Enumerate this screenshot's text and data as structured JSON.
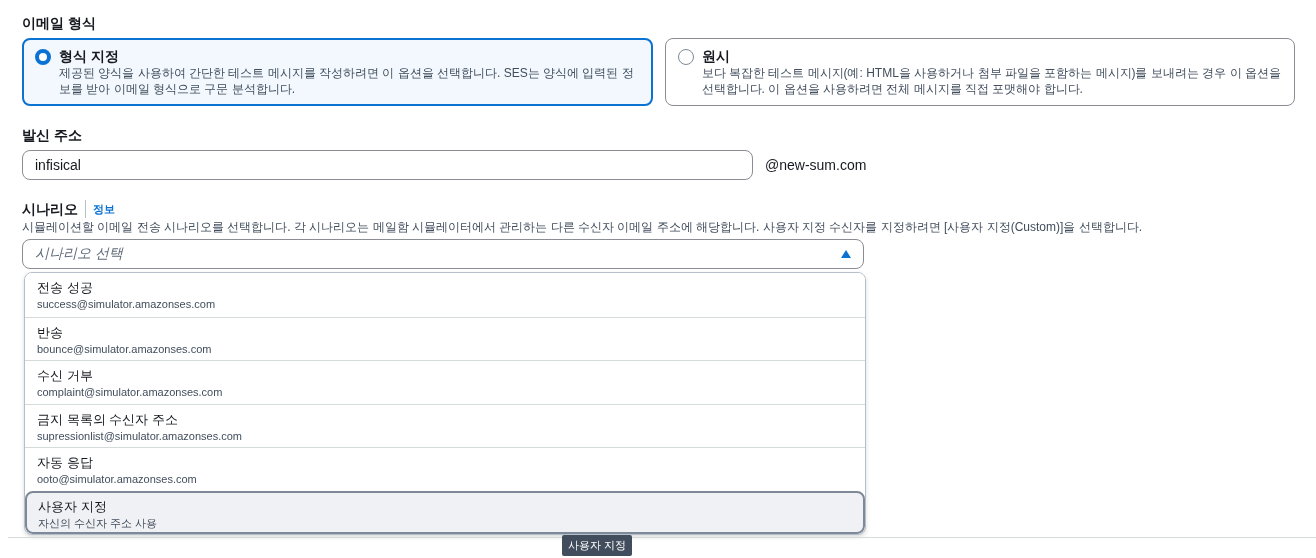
{
  "email_format": {
    "label": "이메일 형식",
    "options": [
      {
        "title": "형식 지정",
        "description": "제공된 양식을 사용하여 간단한 테스트 메시지를 작성하려면 이 옵션을 선택합니다. SES는 양식에 입력된 정보를 받아 이메일 형식으로 구문 분석합니다.",
        "selected": true
      },
      {
        "title": "원시",
        "description": "보다 복잡한 테스트 메시지(예: HTML을 사용하거나 첨부 파일을 포함하는 메시지)를 보내려는 경우 이 옵션을 선택합니다. 이 옵션을 사용하려면 전체 메시지를 직접 포맷해야 합니다.",
        "selected": false
      }
    ]
  },
  "from_address": {
    "label": "발신 주소",
    "value": "infisical",
    "domain": "@new-sum.com"
  },
  "scenario": {
    "label": "시나리오",
    "info_link": "정보",
    "description": "시뮬레이션할 이메일 전송 시나리오를 선택합니다. 각 시나리오는 메일함 시뮬레이터에서 관리하는 다른 수신자 이메일 주소에 해당합니다. 사용자 지정 수신자를 지정하려면 [사용자 지정(Custom)]을 선택합니다.",
    "placeholder": "시나리오 선택",
    "expanded": true,
    "options": [
      {
        "label": "전송 성공",
        "description": "success@simulator.amazonses.com",
        "highlighted": false
      },
      {
        "label": "반송",
        "description": "bounce@simulator.amazonses.com",
        "highlighted": false
      },
      {
        "label": "수신 거부",
        "description": "complaint@simulator.amazonses.com",
        "highlighted": false
      },
      {
        "label": "금지 목록의 수신자 주소",
        "description": "supressionlist@simulator.amazonses.com",
        "highlighted": false
      },
      {
        "label": "자동 응답",
        "description": "ooto@simulator.amazonses.com",
        "highlighted": false
      },
      {
        "label": "사용자 지정",
        "description": "자신의 수신자 주소 사용",
        "highlighted": true
      }
    ],
    "tooltip": "사용자 지정"
  }
}
